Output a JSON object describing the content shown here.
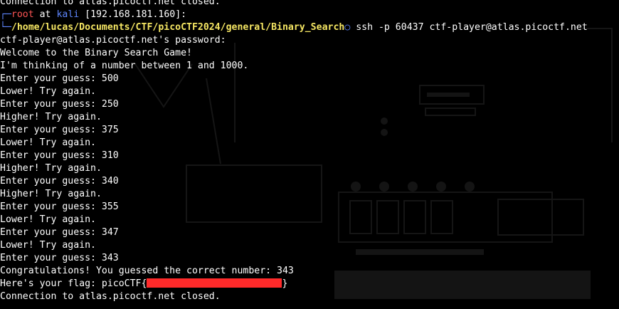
{
  "terminal": {
    "top_line": "Connection to atlas.picoctf.net closed.",
    "prompt": {
      "user": "root",
      "at": "at",
      "host": "kali",
      "ip": "[192.168.181.160]:",
      "path": "/home/lucas/Documents/CTF/picoCTF2024/general/Binary_Search",
      "command": "ssh -p 60437 ctf-player@atlas.picoctf.net"
    },
    "output": [
      "ctf-player@atlas.picoctf.net's password:",
      "Welcome to the Binary Search Game!",
      "I'm thinking of a number between 1 and 1000.",
      "Enter your guess: 500",
      "Lower! Try again.",
      "Enter your guess: 250",
      "Higher! Try again.",
      "Enter your guess: 375",
      "Lower! Try again.",
      "Enter your guess: 310",
      "Higher! Try again.",
      "Enter your guess: 340",
      "Higher! Try again.",
      "Enter your guess: 355",
      "Lower! Try again.",
      "Enter your guess: 347",
      "Lower! Try again.",
      "Enter your guess: 343",
      "Congratulations! You guessed the correct number: 343"
    ],
    "flag_prefix": "Here's your flag: picoCTF{",
    "flag_suffix": "}",
    "closed_line": "Connection to atlas.picoctf.net closed."
  },
  "colors": {
    "background": "#000000",
    "root": "#ff5555",
    "host": "#5f87ff",
    "path": "#f5e663",
    "redaction": "#ff2a2a"
  }
}
